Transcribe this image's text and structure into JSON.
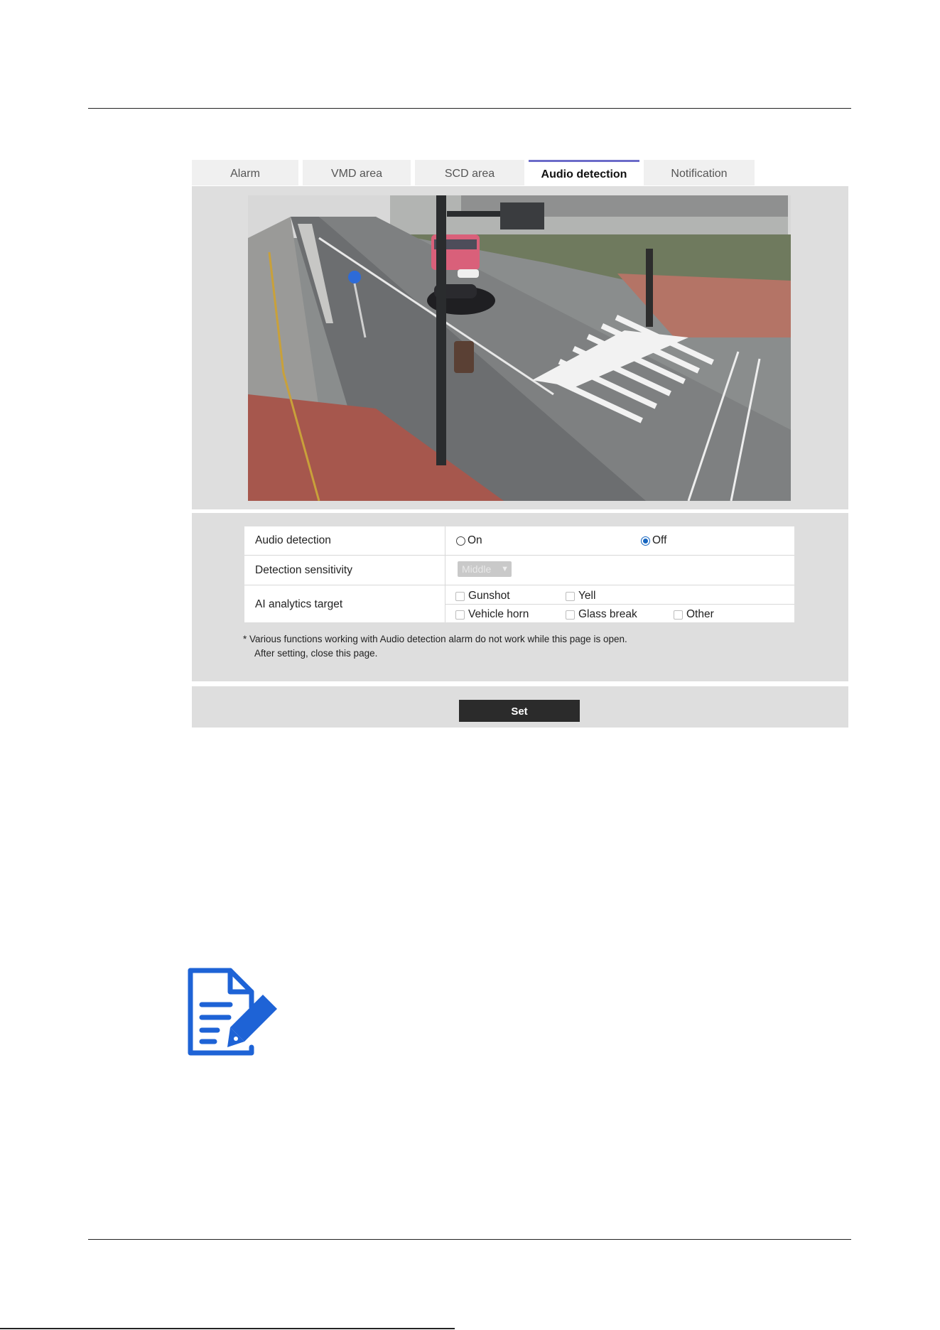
{
  "tabs": [
    {
      "label": "Alarm",
      "active": false
    },
    {
      "label": "VMD area",
      "active": false
    },
    {
      "label": "SCD area",
      "active": false
    },
    {
      "label": "Audio detection",
      "active": true
    },
    {
      "label": "Notification",
      "active": false
    }
  ],
  "settings": {
    "audio_detection": {
      "label": "Audio detection",
      "options": [
        "On",
        "Off"
      ],
      "selected": "Off"
    },
    "detection_sensitivity": {
      "label": "Detection sensitivity",
      "value": "Middle",
      "disabled": true
    },
    "ai_analytics_target": {
      "label": "AI analytics target",
      "options": [
        "Gunshot",
        "Yell",
        "Vehicle horn",
        "Glass break",
        "Other"
      ],
      "checked": []
    }
  },
  "notes": {
    "line1": "* Various functions working with Audio detection alarm do not work while this page is open.",
    "line2": "After setting, close this page."
  },
  "set_button": "Set",
  "icons": {
    "memo": "memo-pen-icon",
    "chevron": "chevron-down-icon"
  },
  "colors": {
    "accent": "#1565c0",
    "tab_active_border": "#6b6bc9",
    "panel_bg": "#dedede",
    "button_bg": "#2b2b2b",
    "memo_icon": "#1e63d6"
  }
}
